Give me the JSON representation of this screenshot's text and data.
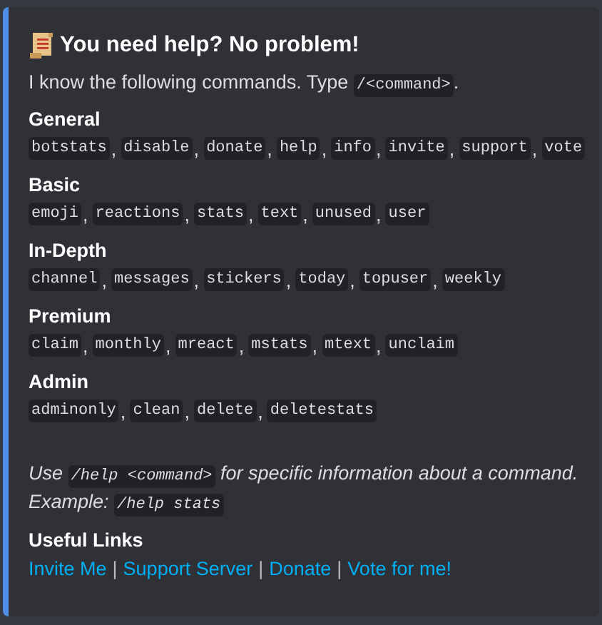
{
  "embed": {
    "title": "You need help? No problem!",
    "description": [
      {
        "kind": "text",
        "text": "I know the following commands. Type "
      },
      {
        "kind": "code",
        "text": "/<command>"
      },
      {
        "kind": "text",
        "text": "."
      }
    ],
    "sections": [
      {
        "name": "General",
        "commands": [
          "botstats",
          "disable",
          "donate",
          "help",
          "info",
          "invite",
          "support",
          "vote"
        ]
      },
      {
        "name": "Basic",
        "commands": [
          "emoji",
          "reactions",
          "stats",
          "text",
          "unused",
          "user"
        ]
      },
      {
        "name": "In-Depth",
        "commands": [
          "channel",
          "messages",
          "stickers",
          "today",
          "topuser",
          "weekly"
        ]
      },
      {
        "name": "Premium",
        "commands": [
          "claim",
          "monthly",
          "mreact",
          "mstats",
          "mtext",
          "unclaim"
        ]
      },
      {
        "name": "Admin",
        "commands": [
          "adminonly",
          "clean",
          "delete",
          "deletestats"
        ]
      }
    ],
    "note": [
      [
        {
          "kind": "text",
          "text": "Use "
        },
        {
          "kind": "code",
          "text": "/help <command>"
        },
        {
          "kind": "text",
          "text": " for specific information about a command."
        }
      ],
      [
        {
          "kind": "text",
          "text": "Example: "
        },
        {
          "kind": "code",
          "text": "/help stats"
        }
      ]
    ],
    "links_heading": "Useful Links",
    "links": [
      {
        "label": "Invite Me"
      },
      {
        "label": "Support Server"
      },
      {
        "label": "Donate"
      },
      {
        "label": "Vote for me!"
      }
    ],
    "link_separator": "|",
    "command_separator": ","
  }
}
